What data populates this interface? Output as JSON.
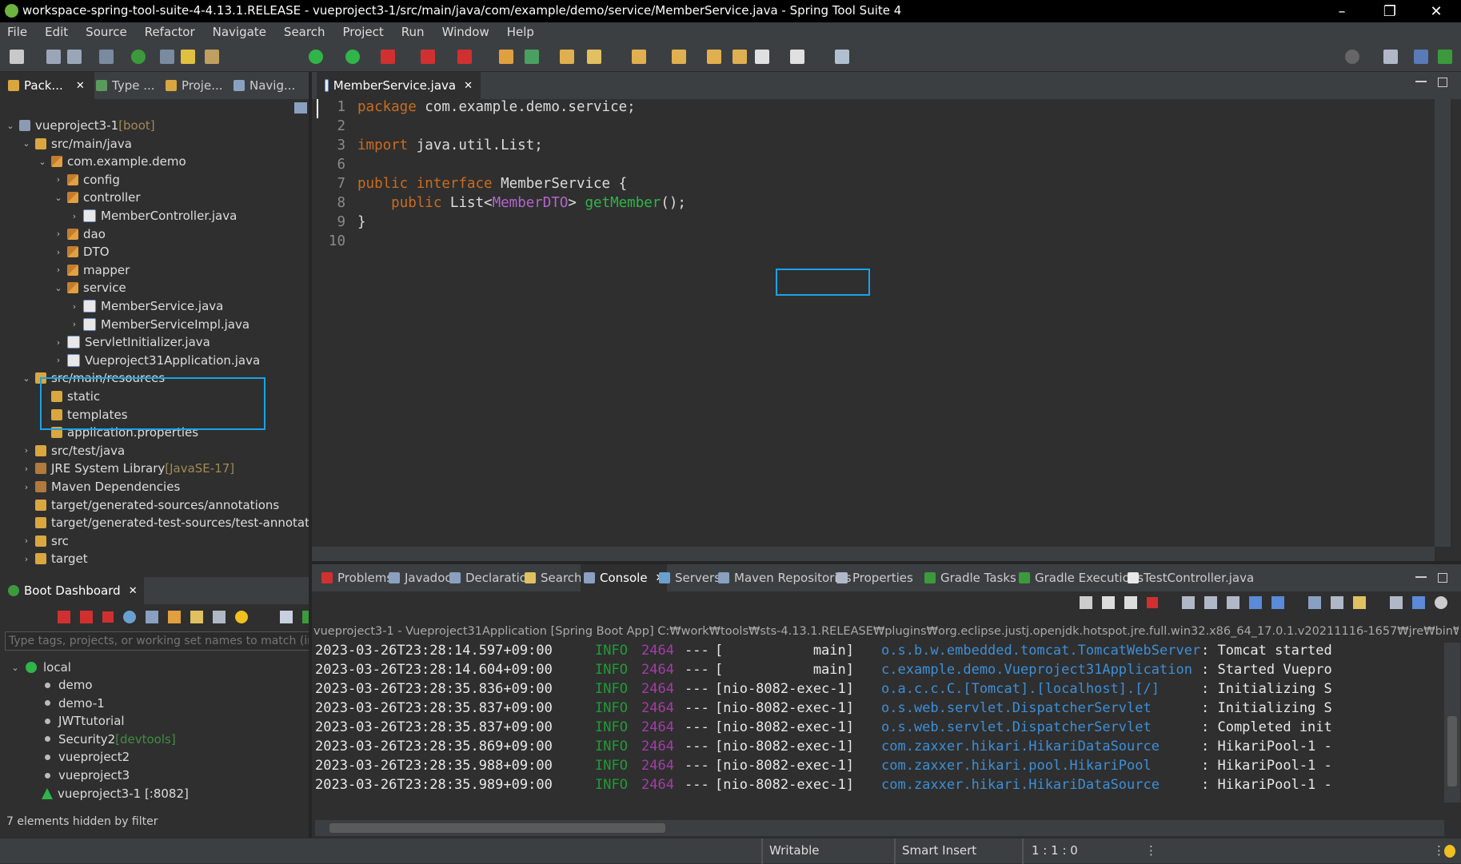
{
  "window": {
    "title": "workspace-spring-tool-suite-4-4.13.1.RELEASE - vueproject3-1/src/main/java/com/example/demo/service/MemberService.java - Spring Tool Suite 4"
  },
  "menu": [
    "File",
    "Edit",
    "Source",
    "Refactor",
    "Navigate",
    "Search",
    "Project",
    "Run",
    "Window",
    "Help"
  ],
  "left_tabs": [
    "Pack...",
    "Type ...",
    "Proje...",
    "Navig..."
  ],
  "tree": [
    {
      "label": "vueproject3-1",
      "suffix": " [boot]",
      "depth": 0,
      "chev": "v",
      "icon": "proj"
    },
    {
      "label": "src/main/java",
      "depth": 1,
      "chev": "v",
      "icon": "folder"
    },
    {
      "label": "com.example.demo",
      "depth": 2,
      "chev": "v",
      "icon": "pkg"
    },
    {
      "label": "config",
      "depth": 3,
      "chev": ">",
      "icon": "pkg"
    },
    {
      "label": "controller",
      "depth": 3,
      "chev": "v",
      "icon": "pkg"
    },
    {
      "label": "MemberController.java",
      "depth": 4,
      "chev": ">",
      "icon": "java"
    },
    {
      "label": "dao",
      "depth": 3,
      "chev": ">",
      "icon": "pkg"
    },
    {
      "label": "DTO",
      "depth": 3,
      "chev": ">",
      "icon": "pkg"
    },
    {
      "label": "mapper",
      "depth": 3,
      "chev": ">",
      "icon": "pkg"
    },
    {
      "label": "service",
      "depth": 3,
      "chev": "v",
      "icon": "pkg"
    },
    {
      "label": "MemberService.java",
      "depth": 4,
      "chev": ">",
      "icon": "java"
    },
    {
      "label": "MemberServiceImpl.java",
      "depth": 4,
      "chev": ">",
      "icon": "java"
    },
    {
      "label": "ServletInitializer.java",
      "depth": 3,
      "chev": ">",
      "icon": "java"
    },
    {
      "label": "Vueproject31Application.java",
      "depth": 3,
      "chev": ">",
      "icon": "java"
    },
    {
      "label": "src/main/resources",
      "depth": 1,
      "chev": "v",
      "icon": "folder"
    },
    {
      "label": "static",
      "depth": 2,
      "chev": "",
      "icon": "folder"
    },
    {
      "label": "templates",
      "depth": 2,
      "chev": "",
      "icon": "folder"
    },
    {
      "label": "application.properties",
      "depth": 2,
      "chev": "",
      "icon": "folder"
    },
    {
      "label": "src/test/java",
      "depth": 1,
      "chev": ">",
      "icon": "folder"
    },
    {
      "label": "JRE System Library",
      "suffix": " [JavaSE-17]",
      "depth": 1,
      "chev": ">",
      "icon": "jar"
    },
    {
      "label": "Maven Dependencies",
      "depth": 1,
      "chev": ">",
      "icon": "jar"
    },
    {
      "label": "target/generated-sources/annotations",
      "depth": 1,
      "chev": "",
      "icon": "folder"
    },
    {
      "label": "target/generated-test-sources/test-annotations",
      "depth": 1,
      "chev": "",
      "icon": "folder"
    },
    {
      "label": "src",
      "depth": 1,
      "chev": ">",
      "icon": "folder"
    },
    {
      "label": "target",
      "depth": 1,
      "chev": ">",
      "icon": "folder"
    }
  ],
  "boot_dashboard": {
    "tab": "Boot Dashboard",
    "filter_placeholder": "Type tags, projects, or working set names to match (incl. * and",
    "group": "local",
    "apps": [
      {
        "name": "demo"
      },
      {
        "name": "demo-1"
      },
      {
        "name": "JWTtutorial"
      },
      {
        "name": "Security2",
        "tag": " [devtools]"
      },
      {
        "name": "vueproject2"
      },
      {
        "name": "vueproject3"
      },
      {
        "name": "vueproject3-1 [:8082]",
        "running": true
      }
    ],
    "footer": "7 elements hidden by filter"
  },
  "editor": {
    "tab": "MemberService.java",
    "lines": [
      {
        "n": "1",
        "parts": [
          [
            "kw",
            "package"
          ],
          [
            "type",
            " com.example.demo.service;"
          ]
        ]
      },
      {
        "n": "2",
        "parts": []
      },
      {
        "n": "3",
        "parts": [
          [
            "kw",
            "import"
          ],
          [
            "type",
            " java.util.List;"
          ]
        ]
      },
      {
        "n": "6",
        "parts": []
      },
      {
        "n": "7",
        "parts": [
          [
            "kw",
            "public"
          ],
          [
            "type",
            " "
          ],
          [
            "kw",
            "interface"
          ],
          [
            "type",
            " MemberService {"
          ]
        ]
      },
      {
        "n": "8",
        "parts": [
          [
            "type",
            "    "
          ],
          [
            "kw",
            "public"
          ],
          [
            "type",
            " List<"
          ],
          [
            "gen",
            "MemberDTO"
          ],
          [
            "type",
            "> "
          ],
          [
            "meth",
            "getMember"
          ],
          [
            "type",
            "();"
          ]
        ]
      },
      {
        "n": "9",
        "parts": [
          [
            "type",
            "}"
          ]
        ]
      },
      {
        "n": "10",
        "parts": []
      }
    ]
  },
  "bottom_tabs": [
    "Problems",
    "Javadoc",
    "Declaration",
    "Search",
    "Console",
    "Servers",
    "Maven Repositories",
    "Properties",
    "Gradle Tasks",
    "Gradle Executions",
    "TestController.java"
  ],
  "console": {
    "header": "vueproject3-1 - Vueproject31Application [Spring Boot App] C:₩work₩tools₩sts-4.13.1.RELEASE₩plugins₩org.eclipse.justj.openjdk.hotspot.jre.full.win32.x86_64_17.0.1.v20211116-1657₩jre₩bin₩javaw.e",
    "lines": [
      {
        "ts": "2023-03-26T23:28:14.597+09:00",
        "lvl": "INFO",
        "pid": "2464",
        "thread": "[           main]",
        "cls": "o.s.b.w.embedded.tomcat.TomcatWebServer",
        "msg": ": Tomcat started"
      },
      {
        "ts": "2023-03-26T23:28:14.604+09:00",
        "lvl": "INFO",
        "pid": "2464",
        "thread": "[           main]",
        "cls": "c.example.demo.Vueproject31Application",
        "msg": ": Started Vuepro"
      },
      {
        "ts": "2023-03-26T23:28:35.836+09:00",
        "lvl": "INFO",
        "pid": "2464",
        "thread": "[nio-8082-exec-1]",
        "cls": "o.a.c.c.C.[Tomcat].[localhost].[/]",
        "msg": ": Initializing S"
      },
      {
        "ts": "2023-03-26T23:28:35.837+09:00",
        "lvl": "INFO",
        "pid": "2464",
        "thread": "[nio-8082-exec-1]",
        "cls": "o.s.web.servlet.DispatcherServlet",
        "msg": ": Initializing S"
      },
      {
        "ts": "2023-03-26T23:28:35.837+09:00",
        "lvl": "INFO",
        "pid": "2464",
        "thread": "[nio-8082-exec-1]",
        "cls": "o.s.web.servlet.DispatcherServlet",
        "msg": ": Completed init"
      },
      {
        "ts": "2023-03-26T23:28:35.869+09:00",
        "lvl": "INFO",
        "pid": "2464",
        "thread": "[nio-8082-exec-1]",
        "cls": "com.zaxxer.hikari.HikariDataSource",
        "msg": ": HikariPool-1 -"
      },
      {
        "ts": "2023-03-26T23:28:35.988+09:00",
        "lvl": "INFO",
        "pid": "2464",
        "thread": "[nio-8082-exec-1]",
        "cls": "com.zaxxer.hikari.pool.HikariPool",
        "msg": ": HikariPool-1 -"
      },
      {
        "ts": "2023-03-26T23:28:35.989+09:00",
        "lvl": "INFO",
        "pid": "2464",
        "thread": "[nio-8082-exec-1]",
        "cls": "com.zaxxer.hikari.HikariDataSource",
        "msg": ": HikariPool-1 -"
      }
    ]
  },
  "status": {
    "writable": "Writable",
    "insert": "Smart Insert",
    "position": "1 : 1 : 0"
  },
  "colors": {
    "highlight": "#1aa3e8",
    "keyword": "#cc6c1d",
    "method": "#2fb54a",
    "info": "#1e9c35",
    "classname": "#3c8fd8"
  }
}
